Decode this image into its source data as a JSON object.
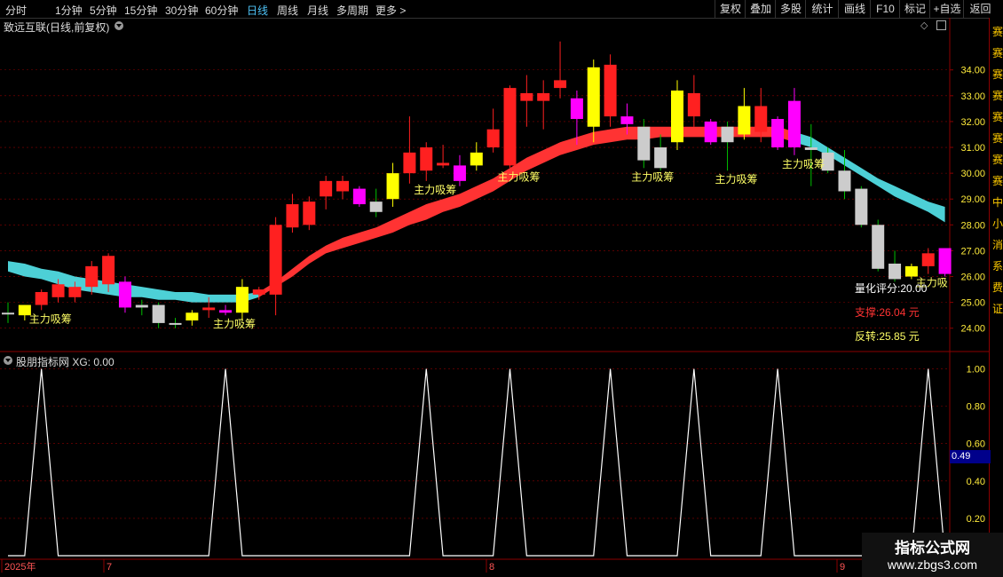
{
  "toolbar": {
    "periods": [
      "分时",
      "1分钟",
      "5分钟",
      "15分钟",
      "30分钟",
      "60分钟",
      "日线",
      "周线",
      "月线",
      "多周期",
      "更多 >"
    ],
    "active": "日线",
    "actions": [
      "复权",
      "叠加",
      "多股",
      "统计",
      "画线",
      "F10",
      "标记",
      "+自选",
      "返回"
    ]
  },
  "main_title": "致远互联(日线,前复权)",
  "sub_title": "股朋指标网 XG: 0.00",
  "annotation_label": "主力吸筹",
  "annotation_label_clip": "主力吸",
  "info": {
    "score": "量化评分:20.00",
    "support": "支撑:26.04 元",
    "reversal": "反转:25.85 元"
  },
  "indicator_readout": "0.49",
  "watermark": {
    "top": "指标公式网",
    "bottom": "www.zbgs3.com"
  },
  "side_labels": [
    "赛",
    "赛",
    "赛",
    "赛",
    "赛",
    "赛",
    "赛",
    "赛",
    "中",
    "小",
    "消",
    "系",
    "费",
    "证"
  ],
  "colors": {
    "up": "#ff2020",
    "down": "#cccccc",
    "yellow": "#ffff00",
    "magenta": "#ff00ff",
    "band_red": "#ff3333",
    "band_cyan": "#4dd0d6",
    "grid": "#8b0000",
    "axis_text": "#ffeb3b"
  },
  "chart_data": [
    {
      "type": "candlestick",
      "title": "致远互联(日线,前复权)",
      "y_ticks": [
        24.0,
        25.0,
        26.0,
        27.0,
        28.0,
        29.0,
        30.0,
        31.0,
        32.0,
        33.0,
        34.0
      ],
      "ylim": [
        23.2,
        35.4
      ],
      "x_labels": [
        "2025年",
        "7",
        "8",
        "9"
      ],
      "candles": [
        {
          "o": 24.6,
          "h": 25.0,
          "l": 24.2,
          "c": 24.6,
          "color": "down"
        },
        {
          "o": 24.5,
          "h": 24.9,
          "l": 24.3,
          "c": 24.9,
          "color": "yellow"
        },
        {
          "o": 24.9,
          "h": 25.5,
          "l": 24.7,
          "c": 25.4,
          "color": "up"
        },
        {
          "o": 25.2,
          "h": 25.9,
          "l": 25.0,
          "c": 25.7,
          "color": "up"
        },
        {
          "o": 25.2,
          "h": 25.8,
          "l": 25.0,
          "c": 25.6,
          "color": "up"
        },
        {
          "o": 25.6,
          "h": 26.6,
          "l": 25.3,
          "c": 26.4,
          "color": "up"
        },
        {
          "o": 25.7,
          "h": 26.9,
          "l": 25.4,
          "c": 26.8,
          "color": "up"
        },
        {
          "o": 25.8,
          "h": 26.0,
          "l": 24.6,
          "c": 24.8,
          "color": "magenta"
        },
        {
          "o": 24.8,
          "h": 25.1,
          "l": 24.5,
          "c": 24.9,
          "color": "down"
        },
        {
          "o": 24.9,
          "h": 25.0,
          "l": 24.0,
          "c": 24.2,
          "color": "down"
        },
        {
          "o": 24.2,
          "h": 24.4,
          "l": 24.0,
          "c": 24.2,
          "color": "down"
        },
        {
          "o": 24.3,
          "h": 24.7,
          "l": 24.1,
          "c": 24.6,
          "color": "yellow"
        },
        {
          "o": 24.7,
          "h": 25.2,
          "l": 24.4,
          "c": 24.8,
          "color": "up"
        },
        {
          "o": 24.7,
          "h": 24.9,
          "l": 24.5,
          "c": 24.6,
          "color": "magenta"
        },
        {
          "o": 24.6,
          "h": 25.9,
          "l": 24.3,
          "c": 25.6,
          "color": "yellow"
        },
        {
          "o": 25.3,
          "h": 25.6,
          "l": 25.1,
          "c": 25.5,
          "color": "up"
        },
        {
          "o": 25.3,
          "h": 28.3,
          "l": 24.5,
          "c": 28.0,
          "color": "up"
        },
        {
          "o": 27.9,
          "h": 29.2,
          "l": 27.7,
          "c": 28.8,
          "color": "up"
        },
        {
          "o": 28.0,
          "h": 29.1,
          "l": 27.8,
          "c": 28.9,
          "color": "up"
        },
        {
          "o": 29.1,
          "h": 29.9,
          "l": 28.6,
          "c": 29.7,
          "color": "up"
        },
        {
          "o": 29.3,
          "h": 29.9,
          "l": 29.0,
          "c": 29.7,
          "color": "up"
        },
        {
          "o": 29.4,
          "h": 29.5,
          "l": 28.7,
          "c": 28.8,
          "color": "magenta"
        },
        {
          "o": 28.9,
          "h": 29.4,
          "l": 28.3,
          "c": 28.5,
          "color": "down"
        },
        {
          "o": 29.0,
          "h": 30.4,
          "l": 28.7,
          "c": 30.0,
          "color": "yellow"
        },
        {
          "o": 30.0,
          "h": 32.2,
          "l": 29.6,
          "c": 30.8,
          "color": "up"
        },
        {
          "o": 30.1,
          "h": 31.2,
          "l": 29.7,
          "c": 31.0,
          "color": "up"
        },
        {
          "o": 30.4,
          "h": 31.1,
          "l": 30.2,
          "c": 30.3,
          "color": "up"
        },
        {
          "o": 30.3,
          "h": 30.7,
          "l": 29.5,
          "c": 29.7,
          "color": "magenta"
        },
        {
          "o": 30.3,
          "h": 31.2,
          "l": 30.1,
          "c": 30.8,
          "color": "yellow"
        },
        {
          "o": 31.0,
          "h": 32.5,
          "l": 30.8,
          "c": 31.7,
          "color": "up"
        },
        {
          "o": 30.3,
          "h": 33.4,
          "l": 30.2,
          "c": 33.3,
          "color": "up"
        },
        {
          "o": 32.8,
          "h": 33.8,
          "l": 31.8,
          "c": 33.1,
          "color": "up"
        },
        {
          "o": 32.8,
          "h": 33.6,
          "l": 31.7,
          "c": 33.1,
          "color": "up"
        },
        {
          "o": 33.3,
          "h": 35.1,
          "l": 32.9,
          "c": 33.6,
          "color": "up"
        },
        {
          "o": 32.1,
          "h": 33.2,
          "l": 31.1,
          "c": 32.9,
          "color": "magenta"
        },
        {
          "o": 31.8,
          "h": 34.4,
          "l": 31.2,
          "c": 34.1,
          "color": "yellow"
        },
        {
          "o": 32.2,
          "h": 34.6,
          "l": 31.8,
          "c": 34.2,
          "color": "up"
        },
        {
          "o": 32.2,
          "h": 32.7,
          "l": 31.5,
          "c": 31.9,
          "color": "magenta"
        },
        {
          "o": 31.8,
          "h": 32.1,
          "l": 30.2,
          "c": 30.5,
          "color": "down"
        },
        {
          "o": 31.0,
          "h": 31.5,
          "l": 30.1,
          "c": 30.2,
          "color": "down"
        },
        {
          "o": 31.2,
          "h": 33.6,
          "l": 30.9,
          "c": 33.2,
          "color": "yellow"
        },
        {
          "o": 32.2,
          "h": 33.8,
          "l": 31.8,
          "c": 33.1,
          "color": "up"
        },
        {
          "o": 32.0,
          "h": 32.1,
          "l": 31.1,
          "c": 31.2,
          "color": "magenta"
        },
        {
          "o": 31.8,
          "h": 32.0,
          "l": 30.1,
          "c": 31.2,
          "color": "down"
        },
        {
          "o": 31.5,
          "h": 33.3,
          "l": 31.3,
          "c": 32.6,
          "color": "yellow"
        },
        {
          "o": 31.6,
          "h": 33.3,
          "l": 31.2,
          "c": 32.6,
          "color": "up"
        },
        {
          "o": 32.1,
          "h": 32.2,
          "l": 30.9,
          "c": 31.0,
          "color": "magenta"
        },
        {
          "o": 31.0,
          "h": 33.3,
          "l": 30.7,
          "c": 32.8,
          "color": "magenta"
        },
        {
          "o": 31.0,
          "h": 31.9,
          "l": 29.5,
          "c": 30.9,
          "color": "down"
        },
        {
          "o": 30.8,
          "h": 31.0,
          "l": 30.0,
          "c": 30.1,
          "color": "down"
        },
        {
          "o": 30.1,
          "h": 30.9,
          "l": 29.0,
          "c": 29.3,
          "color": "down"
        },
        {
          "o": 29.4,
          "h": 29.5,
          "l": 27.9,
          "c": 28.0,
          "color": "down"
        },
        {
          "o": 28.0,
          "h": 28.2,
          "l": 26.2,
          "c": 26.3,
          "color": "down"
        },
        {
          "o": 26.5,
          "h": 27.0,
          "l": 25.8,
          "c": 25.9,
          "color": "down"
        },
        {
          "o": 26.0,
          "h": 26.5,
          "l": 25.9,
          "c": 26.4,
          "color": "yellow"
        },
        {
          "o": 26.4,
          "h": 27.1,
          "l": 26.1,
          "c": 26.9,
          "color": "up"
        },
        {
          "o": 27.1,
          "h": 27.1,
          "l": 26.0,
          "c": 26.1,
          "color": "magenta"
        }
      ],
      "band_upper": [
        26.6,
        26.5,
        26.3,
        26.2,
        26.0,
        25.9,
        25.8,
        25.7,
        25.6,
        25.5,
        25.4,
        25.4,
        25.3,
        25.3,
        25.3,
        25.4,
        25.8,
        26.3,
        26.8,
        27.2,
        27.5,
        27.7,
        27.9,
        28.2,
        28.5,
        28.8,
        29.0,
        29.2,
        29.5,
        29.8,
        30.2,
        30.6,
        30.9,
        31.2,
        31.4,
        31.6,
        31.7,
        31.8,
        31.8,
        31.8,
        31.8,
        31.8,
        31.8,
        31.8,
        31.8,
        31.8,
        31.8,
        31.6,
        31.4,
        31.0,
        30.6,
        30.2,
        29.8,
        29.5,
        29.2,
        28.9,
        28.7
      ],
      "band_lower": [
        26.2,
        26.0,
        25.9,
        25.7,
        25.5,
        25.4,
        25.3,
        25.2,
        25.2,
        25.1,
        25.1,
        25.0,
        25.0,
        25.0,
        25.0,
        25.2,
        25.6,
        26.0,
        26.5,
        26.9,
        27.1,
        27.3,
        27.5,
        27.7,
        28.0,
        28.2,
        28.5,
        28.7,
        29.0,
        29.3,
        29.7,
        30.1,
        30.4,
        30.7,
        30.9,
        31.1,
        31.2,
        31.3,
        31.3,
        31.4,
        31.4,
        31.4,
        31.4,
        31.4,
        31.4,
        31.4,
        31.4,
        31.2,
        31.0,
        30.7,
        30.3,
        29.9,
        29.5,
        29.1,
        28.8,
        28.5,
        28.1
      ],
      "signal_indices": [
        2,
        13,
        25,
        30,
        38,
        43,
        47,
        55
      ]
    },
    {
      "type": "line",
      "title": "股朋指标网 XG: 0.00",
      "series_name": "XG",
      "y_ticks": [
        0.2,
        0.4,
        0.6,
        0.8,
        1.0
      ],
      "ylim": [
        0,
        1.05
      ],
      "values": [
        0,
        0,
        1,
        0,
        0,
        0,
        0,
        0,
        0,
        0,
        0,
        0,
        0,
        1,
        0,
        0,
        0,
        0,
        0,
        0,
        0,
        0,
        0,
        0,
        0,
        1,
        0,
        0,
        0,
        0,
        1,
        0,
        0,
        0,
        0,
        0,
        1,
        0,
        0,
        0,
        0,
        1,
        0,
        0,
        0,
        0,
        1,
        0,
        0,
        0,
        0,
        0,
        0,
        0,
        0,
        1,
        0
      ]
    }
  ]
}
